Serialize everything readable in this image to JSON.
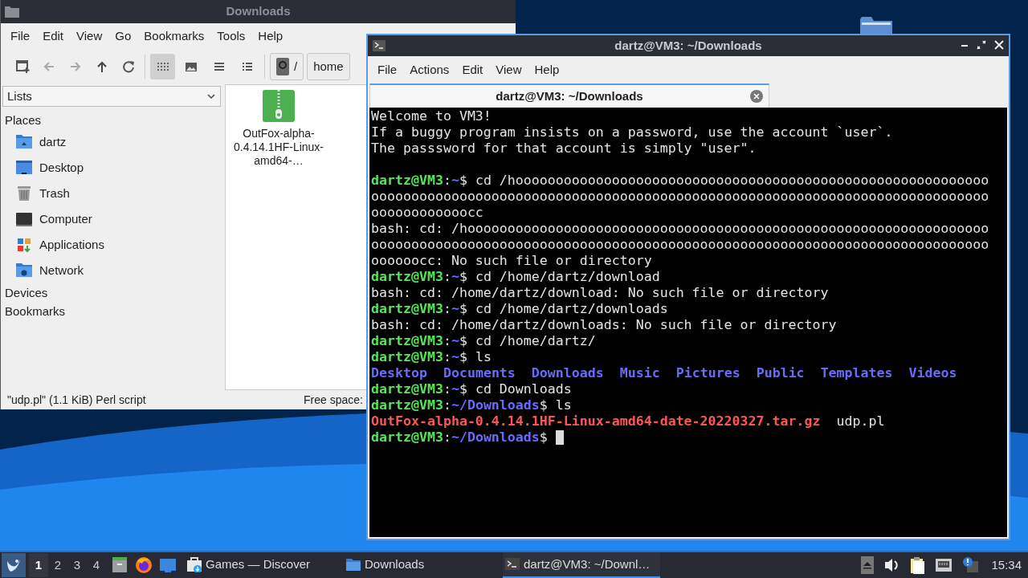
{
  "file_manager": {
    "title": "Downloads",
    "menu": [
      "File",
      "Edit",
      "View",
      "Go",
      "Bookmarks",
      "Tools",
      "Help"
    ],
    "view_modes": [
      {
        "kind": "icons",
        "selected": true
      },
      {
        "kind": "thumbnails",
        "selected": false
      },
      {
        "kind": "compact",
        "selected": false
      },
      {
        "kind": "details",
        "selected": false
      }
    ],
    "path": [
      {
        "kind": "root",
        "label": "/"
      },
      {
        "kind": "folder",
        "label": "home"
      }
    ],
    "side_pane_mode": "Lists",
    "sections": [
      {
        "label": "Places",
        "items": [
          {
            "kind": "home",
            "label": "dartz"
          },
          {
            "kind": "desktop",
            "label": "Desktop"
          },
          {
            "kind": "trash",
            "label": "Trash"
          },
          {
            "kind": "computer",
            "label": "Computer"
          },
          {
            "kind": "applications",
            "label": "Applications"
          },
          {
            "kind": "network",
            "label": "Network"
          }
        ]
      },
      {
        "label": "Devices"
      },
      {
        "label": "Bookmarks"
      }
    ],
    "files": [
      {
        "name": "OutFox-alpha-0.4.14.1HF-Linux-amd64-…"
      }
    ],
    "status": "\"udp.pl\" (1.1 KiB) Perl script",
    "free_space": "Free space:"
  },
  "terminal": {
    "title": "dartz@VM3: ~/Downloads",
    "menu": [
      "File",
      "Actions",
      "Edit",
      "View",
      "Help"
    ],
    "tabs": [
      {
        "label": "dartz@VM3: ~/Downloads",
        "selected": true
      }
    ],
    "lines": [
      {
        "segments": [
          {
            "kind": "plain",
            "text": "Welcome to VM3!"
          }
        ]
      },
      {
        "segments": [
          {
            "kind": "plain",
            "text": "If a buggy program insists on a password, use the account `user`."
          }
        ]
      },
      {
        "segments": [
          {
            "kind": "plain",
            "text": "The passsword for that account is simply \"user\"."
          }
        ]
      },
      {
        "kind": "blank"
      },
      {
        "segments": [
          {
            "kind": "user",
            "text": "dartz@VM3"
          },
          {
            "kind": "plain",
            "text": ":"
          },
          {
            "kind": "path",
            "text": "~"
          },
          {
            "kind": "plain",
            "text": "$ cd /hooooooooooooooooooooooooooooooooooooooooooooooooooooooooooo"
          }
        ]
      },
      {
        "segments": [
          {
            "kind": "plain",
            "text": "ooooooooooooooooooooooooooooooooooooooooooooooooooooooooooooooooooooooooooooo"
          }
        ]
      },
      {
        "segments": [
          {
            "kind": "plain",
            "text": "oooooooooooocc"
          }
        ]
      },
      {
        "segments": [
          {
            "kind": "plain",
            "text": "bash: cd: /hooooooooooooooooooooooooooooooooooooooooooooooooooooooooooooooooo"
          }
        ]
      },
      {
        "segments": [
          {
            "kind": "plain",
            "text": "ooooooooooooooooooooooooooooooooooooooooooooooooooooooooooooooooooooooooooooo"
          }
        ]
      },
      {
        "segments": [
          {
            "kind": "plain",
            "text": "oooooocc: No such file or directory"
          }
        ]
      },
      {
        "segments": [
          {
            "kind": "user",
            "text": "dartz@VM3"
          },
          {
            "kind": "plain",
            "text": ":"
          },
          {
            "kind": "path",
            "text": "~"
          },
          {
            "kind": "plain",
            "text": "$ cd /home/dartz/download"
          }
        ]
      },
      {
        "segments": [
          {
            "kind": "plain",
            "text": "bash: cd: /home/dartz/download: No such file or directory"
          }
        ]
      },
      {
        "segments": [
          {
            "kind": "user",
            "text": "dartz@VM3"
          },
          {
            "kind": "plain",
            "text": ":"
          },
          {
            "kind": "path",
            "text": "~"
          },
          {
            "kind": "plain",
            "text": "$ cd /home/dartz/downloads"
          }
        ]
      },
      {
        "segments": [
          {
            "kind": "plain",
            "text": "bash: cd: /home/dartz/downloads: No such file or directory"
          }
        ]
      },
      {
        "segments": [
          {
            "kind": "user",
            "text": "dartz@VM3"
          },
          {
            "kind": "plain",
            "text": ":"
          },
          {
            "kind": "path",
            "text": "~"
          },
          {
            "kind": "plain",
            "text": "$ cd /home/dartz/"
          }
        ]
      },
      {
        "segments": [
          {
            "kind": "user",
            "text": "dartz@VM3"
          },
          {
            "kind": "plain",
            "text": ":"
          },
          {
            "kind": "path",
            "text": "~"
          },
          {
            "kind": "plain",
            "text": "$ ls"
          }
        ]
      },
      {
        "segments": [
          {
            "kind": "dir",
            "text": "Desktop"
          },
          {
            "kind": "dir",
            "text": "Documents"
          },
          {
            "kind": "dir",
            "text": "Downloads"
          },
          {
            "kind": "dir",
            "text": "Music"
          },
          {
            "kind": "dir",
            "text": "Pictures"
          },
          {
            "kind": "dir",
            "text": "Public"
          },
          {
            "kind": "dir",
            "text": "Templates"
          },
          {
            "kind": "dir",
            "text": "Videos"
          }
        ]
      },
      {
        "segments": [
          {
            "kind": "user",
            "text": "dartz@VM3"
          },
          {
            "kind": "plain",
            "text": ":"
          },
          {
            "kind": "path",
            "text": "~"
          },
          {
            "kind": "plain",
            "text": "$ cd Downloads"
          }
        ]
      },
      {
        "segments": [
          {
            "kind": "user",
            "text": "dartz@VM3"
          },
          {
            "kind": "plain",
            "text": ":"
          },
          {
            "kind": "path",
            "text": "~/Downloads"
          },
          {
            "kind": "plain",
            "text": "$ ls"
          }
        ]
      },
      {
        "segments": [
          {
            "kind": "archive",
            "text": "OutFox-alpha-0.4.14.1HF-Linux-amd64-date-20220327.tar.gz"
          },
          {
            "kind": "plain",
            "text": "udp.pl"
          }
        ]
      },
      {
        "segments": [
          {
            "kind": "user",
            "text": "dartz@VM3"
          },
          {
            "kind": "plain",
            "text": ":"
          },
          {
            "kind": "path",
            "text": "~/Downloads"
          },
          {
            "kind": "plain",
            "text": "$ "
          }
        ],
        "cursor": true
      }
    ]
  },
  "taskbar": {
    "workspaces": [
      {
        "label": "1",
        "selected": true
      },
      {
        "label": "2",
        "selected": false
      },
      {
        "label": "3",
        "selected": false
      },
      {
        "label": "4",
        "selected": false
      }
    ],
    "launchers": [
      {
        "kind": "files"
      },
      {
        "kind": "browser"
      },
      {
        "kind": "desktop"
      }
    ],
    "tasks": [
      {
        "kind": "store",
        "label": "Games — Discover",
        "selected": false
      },
      {
        "kind": "folder",
        "label": "Downloads",
        "selected": false
      },
      {
        "kind": "terminal",
        "label": "dartz@VM3: ~/Downl…",
        "selected": true
      }
    ],
    "tray": [
      {
        "kind": "eject"
      },
      {
        "kind": "volume"
      },
      {
        "kind": "clipboard"
      },
      {
        "kind": "network"
      },
      {
        "kind": "update"
      }
    ],
    "clock": "15:34"
  }
}
